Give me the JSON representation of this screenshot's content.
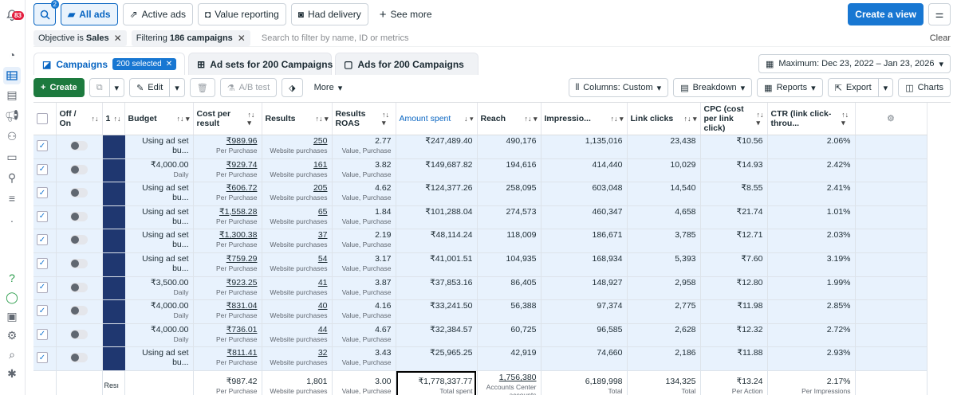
{
  "rail": {
    "notification_count": "83",
    "icons": [
      "bell-icon",
      "dashboard-icon",
      "table-icon",
      "pages-icon",
      "megaphone-icon",
      "people-icon",
      "billing-icon",
      "audience-icon",
      "menu-icon",
      "dot-icon",
      "help-icon",
      "chat-icon",
      "report-icon",
      "settings-icon",
      "search-icon",
      "bug-icon"
    ]
  },
  "topbar": {
    "search_count": "2",
    "all_ads": "All ads",
    "active_ads": "Active ads",
    "value_reporting": "Value reporting",
    "had_delivery": "Had delivery",
    "see_more": "See more",
    "create_view": "Create a view"
  },
  "filterbar": {
    "chip1_prefix": "Objective is",
    "chip1_value": "Sales",
    "chip2_prefix": "Filtering",
    "chip2_value": "186 campaigns",
    "placeholder": "Search to filter by name, ID or metrics",
    "clear": "Clear"
  },
  "tabs": {
    "campaigns": "Campaigns",
    "selected": "200 selected",
    "adsets": "Ad sets for 200 Campaigns",
    "ads": "Ads for 200 Campaigns",
    "date_range": "Maximum: Dec 23, 2022 – Jan 23, 2026"
  },
  "actions": {
    "create": "Create",
    "edit": "Edit",
    "ab_test": "A/B test",
    "more": "More",
    "columns": "Columns: Custom",
    "breakdown": "Breakdown",
    "reports": "Reports",
    "export": "Export",
    "charts": "Charts"
  },
  "columns": {
    "off_on": "Off / On",
    "name_num": "1",
    "budget": "Budget",
    "cost_per_result": "Cost per result",
    "results": "Results",
    "results_roas": "Results ROAS",
    "amount_spent": "Amount spent",
    "reach": "Reach",
    "impressions": "Impressio...",
    "link_clicks": "Link clicks",
    "cpc": "CPC (cost per link click)",
    "ctr": "CTR (link click-throu..."
  },
  "rows": [
    {
      "budget": "Using ad set bu...",
      "budget_sub": "",
      "cpr": "₹989.96",
      "cpr_sub": "Per Purchase",
      "results": "250",
      "results_sub": "Website purchases",
      "roas": "2.77",
      "roas_sub": "Value, Purchase",
      "spent": "₹247,489.40",
      "reach": "490,176",
      "impr": "1,135,016",
      "clicks": "23,438",
      "cpc": "₹10.56",
      "ctr": "2.06%"
    },
    {
      "budget": "₹4,000.00",
      "budget_sub": "Daily",
      "cpr": "₹929.74",
      "cpr_sub": "Per Purchase",
      "results": "161",
      "results_sub": "Website purchases",
      "roas": "3.82",
      "roas_sub": "Value, Purchase",
      "spent": "₹149,687.82",
      "reach": "194,616",
      "impr": "414,440",
      "clicks": "10,029",
      "cpc": "₹14.93",
      "ctr": "2.42%"
    },
    {
      "budget": "Using ad set bu...",
      "budget_sub": "",
      "cpr": "₹606.72",
      "cpr_sub": "Per Purchase",
      "results": "205",
      "results_sub": "Website purchases",
      "roas": "4.62",
      "roas_sub": "Value, Purchase",
      "spent": "₹124,377.26",
      "reach": "258,095",
      "impr": "603,048",
      "clicks": "14,540",
      "cpc": "₹8.55",
      "ctr": "2.41%"
    },
    {
      "budget": "Using ad set bu...",
      "budget_sub": "",
      "cpr": "₹1,558.28",
      "cpr_sub": "Per Purchase",
      "results": "65",
      "results_sub": "Website purchases",
      "roas": "1.84",
      "roas_sub": "Value, Purchase",
      "spent": "₹101,288.04",
      "reach": "274,573",
      "impr": "460,347",
      "clicks": "4,658",
      "cpc": "₹21.74",
      "ctr": "1.01%"
    },
    {
      "budget": "Using ad set bu...",
      "budget_sub": "",
      "cpr": "₹1,300.38",
      "cpr_sub": "Per Purchase",
      "results": "37",
      "results_sub": "Website purchases",
      "roas": "2.19",
      "roas_sub": "Value, Purchase",
      "spent": "₹48,114.24",
      "reach": "118,009",
      "impr": "186,671",
      "clicks": "3,785",
      "cpc": "₹12.71",
      "ctr": "2.03%"
    },
    {
      "budget": "Using ad set bu...",
      "budget_sub": "",
      "cpr": "₹759.29",
      "cpr_sub": "Per Purchase",
      "results": "54",
      "results_sub": "Website purchases",
      "roas": "3.17",
      "roas_sub": "Value, Purchase",
      "spent": "₹41,001.51",
      "reach": "104,935",
      "impr": "168,934",
      "clicks": "5,393",
      "cpc": "₹7.60",
      "ctr": "3.19%"
    },
    {
      "budget": "₹3,500.00",
      "budget_sub": "Daily",
      "cpr": "₹923.25",
      "cpr_sub": "Per Purchase",
      "results": "41",
      "results_sub": "Website purchases",
      "roas": "3.87",
      "roas_sub": "Value, Purchase",
      "spent": "₹37,853.16",
      "reach": "86,405",
      "impr": "148,927",
      "clicks": "2,958",
      "cpc": "₹12.80",
      "ctr": "1.99%"
    },
    {
      "budget": "₹4,000.00",
      "budget_sub": "Daily",
      "cpr": "₹831.04",
      "cpr_sub": "Per Purchase",
      "results": "40",
      "results_sub": "Website purchases",
      "roas": "4.16",
      "roas_sub": "Value, Purchase",
      "spent": "₹33,241.50",
      "reach": "56,388",
      "impr": "97,374",
      "clicks": "2,775",
      "cpc": "₹11.98",
      "ctr": "2.85%"
    },
    {
      "budget": "₹4,000.00",
      "budget_sub": "Daily",
      "cpr": "₹736.01",
      "cpr_sub": "Per Purchase",
      "results": "44",
      "results_sub": "Website purchases",
      "roas": "4.67",
      "roas_sub": "Value, Purchase",
      "spent": "₹32,384.57",
      "reach": "60,725",
      "impr": "96,585",
      "clicks": "2,628",
      "cpc": "₹12.32",
      "ctr": "2.72%"
    },
    {
      "budget": "Using ad set bu...",
      "budget_sub": "",
      "cpr": "₹811.41",
      "cpr_sub": "Per Purchase",
      "results": "32",
      "results_sub": "Website purchases",
      "roas": "3.43",
      "roas_sub": "Value, Purchase",
      "spent": "₹25,965.25",
      "reach": "42,919",
      "impr": "74,660",
      "clicks": "2,186",
      "cpc": "₹11.88",
      "ctr": "2.93%"
    }
  ],
  "footer": {
    "name": "Resı",
    "cpr": "₹987.42",
    "cpr_sub": "Per Purchase",
    "results": "1,801",
    "results_sub": "Website purchases",
    "roas": "3.00",
    "roas_sub": "Value, Purchase",
    "spent": "₹1,778,337.77",
    "spent_sub": "Total spent",
    "reach": "1,756,380",
    "reach_sub": "Accounts Center accounts",
    "impr": "6,189,998",
    "impr_sub": "Total",
    "clicks": "134,325",
    "clicks_sub": "Total",
    "cpc": "₹13.24",
    "cpc_sub": "Per Action",
    "ctr": "2.17%",
    "ctr_sub": "Per Impressions"
  }
}
